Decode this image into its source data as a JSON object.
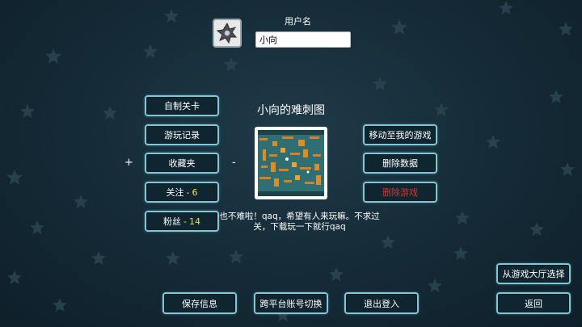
{
  "profile": {
    "username_label": "用户名",
    "username_value": "小向",
    "avatar_icon": "star-badge-icon"
  },
  "left_menu": {
    "custom_levels": "自制关卡",
    "play_history": "游玩记录",
    "favorites": "收藏夹",
    "following_label": "关注",
    "following_count": "6",
    "followers_label": "粉丝",
    "followers_count": "14",
    "sep": "-"
  },
  "level": {
    "title": "小向的难刺图",
    "description": "也不难啦！qaq，希望有人来玩嘛。不求过关，下载玩一下就行qaq"
  },
  "right_menu": {
    "move_to_my_games": "移动至我的游戏",
    "delete_data": "删除数据",
    "delete_game": "删除游戏"
  },
  "controls": {
    "plus": "+",
    "minus": "-"
  },
  "bottom_bar": {
    "save_info": "保存信息",
    "cross_platform_switch": "跨平台账号切换",
    "logout": "退出登入",
    "select_from_lobby": "从游戏大厅选择",
    "back": "返回"
  },
  "colors": {
    "background": "#142a36",
    "button_border": "#7ec8d8",
    "count_highlight": "#f4e04a",
    "danger_text": "#e03030"
  }
}
